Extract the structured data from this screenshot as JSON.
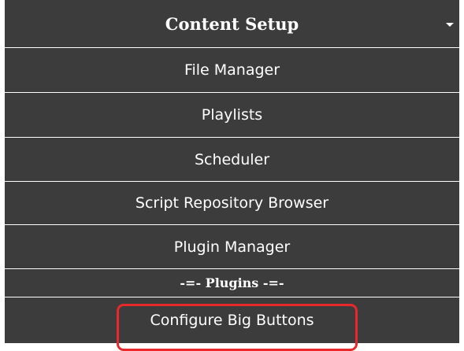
{
  "menu": {
    "header": {
      "title": "Content Setup",
      "caret_icon": "caret-down-icon"
    },
    "items": [
      {
        "label": "File Manager"
      },
      {
        "label": "Playlists"
      },
      {
        "label": "Scheduler"
      },
      {
        "label": "Script Repository Browser"
      },
      {
        "label": "Plugin Manager"
      }
    ],
    "section_divider": "-=- Plugins -=-",
    "plugin_items": [
      {
        "label": "Configure Big Buttons"
      }
    ]
  },
  "colors": {
    "menu_background": "#3c3c3c",
    "text": "#ffffff",
    "separator": "#ffffff",
    "highlight": "#e8282b"
  }
}
